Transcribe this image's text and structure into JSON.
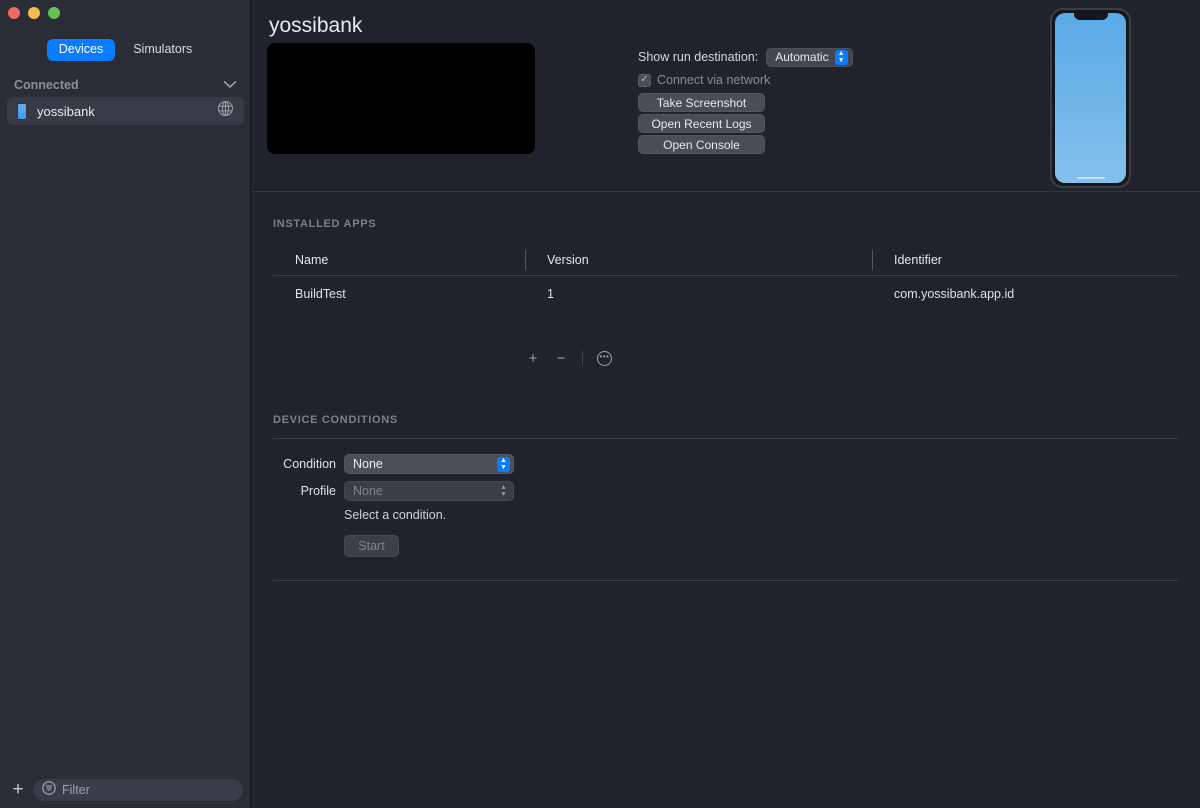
{
  "sidebar": {
    "tabs": [
      {
        "label": "Devices",
        "active": true
      },
      {
        "label": "Simulators",
        "active": false
      }
    ],
    "group_label": "Connected",
    "chevron": "⌄",
    "devices": [
      {
        "name": "yossibank",
        "network_icon": "globe-icon"
      }
    ],
    "bottom": {
      "add_label": "+",
      "filter_placeholder": "Filter"
    }
  },
  "header": {
    "device_title": "yossibank",
    "run_destination_label": "Show run destination:",
    "run_destination_value": "Automatic",
    "connect_via_network_label": "Connect via network",
    "connect_via_network_checked": "✓",
    "buttons": [
      {
        "label": "Take Screenshot"
      },
      {
        "label": "Open Recent Logs"
      },
      {
        "label": "Open Console"
      }
    ]
  },
  "installed_apps": {
    "section_title": "INSTALLED APPS",
    "columns": [
      "Name",
      "Version",
      "Identifier"
    ],
    "rows": [
      {
        "name": "BuildTest",
        "version": "1",
        "identifier": "com.yossibank.app.id"
      }
    ],
    "toolbar": {
      "add": "+",
      "remove": "−",
      "more": "•••"
    }
  },
  "device_conditions": {
    "section_title": "DEVICE CONDITIONS",
    "condition_label": "Condition",
    "condition_value": "None",
    "profile_label": "Profile",
    "profile_value": "None",
    "hint": "Select a condition.",
    "start_label": "Start"
  },
  "colors": {
    "accent": "#0a7cff",
    "sidebar_bg": "#2b2d36",
    "main_bg": "#21232c",
    "thumbnail_bg": "#000000",
    "phone_screen": "#6fb4e8"
  }
}
